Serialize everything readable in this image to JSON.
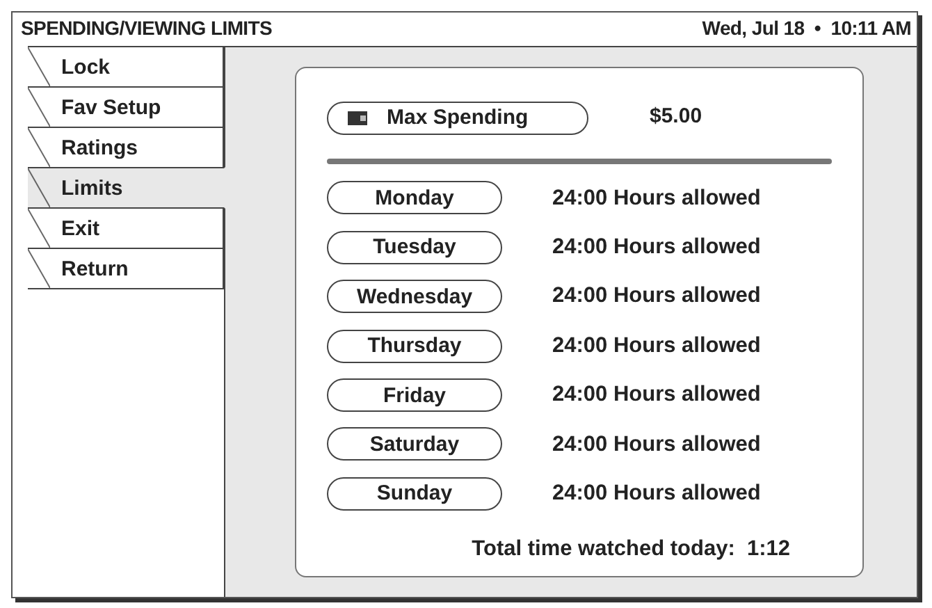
{
  "header": {
    "title": "SPENDING/VIEWING LIMITS",
    "date": "Wed, Jul 18",
    "separator": "•",
    "time": "10:11 AM"
  },
  "tabs": [
    {
      "label": "Lock",
      "selected": false
    },
    {
      "label": "Fav Setup",
      "selected": false
    },
    {
      "label": "Ratings",
      "selected": false
    },
    {
      "label": "Limits",
      "selected": true
    },
    {
      "label": "Exit",
      "selected": false
    },
    {
      "label": "Return",
      "selected": false
    }
  ],
  "max_spending": {
    "label": "Max Spending",
    "value": "$5.00"
  },
  "days": [
    {
      "day": "Monday",
      "allowance": "24:00 Hours allowed"
    },
    {
      "day": "Tuesday",
      "allowance": "24:00 Hours allowed"
    },
    {
      "day": "Wednesday",
      "allowance": "24:00 Hours allowed"
    },
    {
      "day": "Thursday",
      "allowance": "24:00 Hours allowed"
    },
    {
      "day": "Friday",
      "allowance": "24:00 Hours allowed"
    },
    {
      "day": "Saturday",
      "allowance": "24:00 Hours allowed"
    },
    {
      "day": "Sunday",
      "allowance": "24:00 Hours allowed"
    }
  ],
  "total": {
    "label": "Total time watched today:",
    "value": "1:12"
  }
}
